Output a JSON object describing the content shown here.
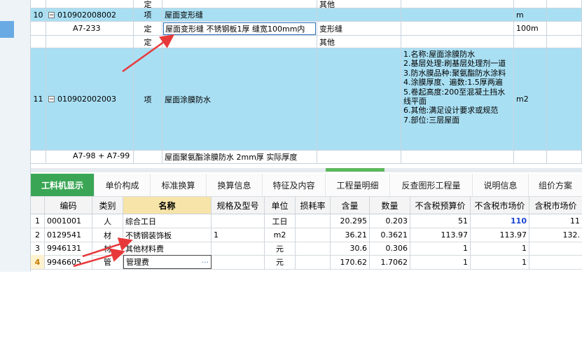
{
  "top_rows": [
    {
      "num": "",
      "code": "",
      "kind": "定",
      "name": "",
      "feature": "其他",
      "unit": "",
      "selected": false
    },
    {
      "num": "10",
      "code": "010902008002",
      "kind": "项",
      "name": "屋面变形缝",
      "feature": "",
      "unit": "m",
      "selected": true
    },
    {
      "num": "",
      "code": "A7-233",
      "kind": "定",
      "name": "屋面变形缝 不锈钢板1厚 缝宽100mm内",
      "feature": "变形缝",
      "unit": "100m",
      "selected": false
    },
    {
      "num": "",
      "code": "",
      "kind": "定",
      "name": "",
      "feature": "其他",
      "unit": "",
      "selected": false
    },
    {
      "num": "11",
      "code": "010902002003",
      "kind": "项",
      "name": "屋面涂膜防水",
      "feature": "1.名称:屋面涂膜防水\n2.基层处理:刷基层处理剂一道\n3.防水膜品种:聚氨酯防水涂料\n4.涂膜厚度、遍数:1.5厚两遍\n5.卷起高度:200至混凝土挡水线平面\n6.其他:满足设计要求或规范\n7.部位:三层屋面",
      "unit": "m2",
      "selected": true
    },
    {
      "num": "",
      "code": "A7-98 + A7-99",
      "kind": "",
      "name": "屋面聚氨酯涂膜防水 2mm厚 实际厚度",
      "feature": "",
      "unit": "",
      "selected": false
    }
  ],
  "tabs": [
    "工料机显示",
    "单价构成",
    "标准换算",
    "换算信息",
    "特征及内容",
    "工程量明细",
    "反查图形工程量",
    "说明信息",
    "组价方案"
  ],
  "bottom_headers": [
    "",
    "编码",
    "类别",
    "名称",
    "规格及型号",
    "单位",
    "损耗率",
    "含量",
    "数量",
    "不含税预算价",
    "不含税市场价",
    "含税市场价"
  ],
  "bottom_rows": [
    {
      "n": "1",
      "code": "0001001",
      "cat": "人",
      "name": "综合工日",
      "spec": "",
      "unit": "工日",
      "loss": "",
      "qty_per": "20.295",
      "qty": "0.203",
      "budget": "51",
      "market": "110",
      "tax_market": "11"
    },
    {
      "n": "2",
      "code": "0129541",
      "cat": "材",
      "name": "不锈钢装饰板",
      "spec": "1",
      "unit": "m2",
      "loss": "",
      "qty_per": "36.21",
      "qty": "0.3621",
      "budget": "113.97",
      "market": "113.97",
      "tax_market": "132."
    },
    {
      "n": "3",
      "code": "9946131",
      "cat": "材",
      "name": "其他材料费",
      "spec": "",
      "unit": "元",
      "loss": "",
      "qty_per": "30.6",
      "qty": "0.306",
      "budget": "1",
      "market": "1",
      "tax_market": ""
    },
    {
      "n": "4",
      "code": "9946605",
      "cat": "管",
      "name": "管理费",
      "spec": "",
      "unit": "元",
      "loss": "",
      "qty_per": "170.62",
      "qty": "1.7062",
      "budget": "1",
      "market": "1",
      "tax_market": ""
    }
  ],
  "name_cell_dots": "···",
  "colors": {
    "accent": "#3aa655",
    "selection": "#a9dff3",
    "header_highlight": "#f7e4a8",
    "arrow": "#e8393a"
  }
}
